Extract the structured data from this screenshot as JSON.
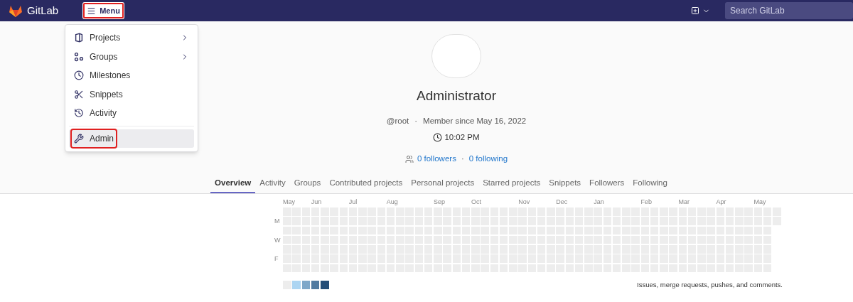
{
  "navbar": {
    "brand": "GitLab",
    "menu_button": {
      "label": "Menu",
      "highlighted": true
    },
    "search": {
      "placeholder": "Search GitLab"
    }
  },
  "menu": {
    "items": [
      {
        "kind": "projects",
        "label": "Projects",
        "submenu": true,
        "selected": false,
        "highlighted": false
      },
      {
        "kind": "groups",
        "label": "Groups",
        "submenu": true,
        "selected": false,
        "highlighted": false
      },
      {
        "kind": "milestones",
        "label": "Milestones",
        "submenu": false,
        "selected": false,
        "highlighted": false
      },
      {
        "kind": "snippets",
        "label": "Snippets",
        "submenu": false,
        "selected": false,
        "highlighted": false
      },
      {
        "kind": "activity",
        "label": "Activity",
        "submenu": false,
        "selected": false,
        "highlighted": false
      },
      {
        "kind": "admin",
        "label": "Admin",
        "submenu": false,
        "selected": true,
        "highlighted": true
      }
    ]
  },
  "profile": {
    "name": "Administrator",
    "username": "@root",
    "separator": "·",
    "member_since": "Member since May 16, 2022",
    "local_time": "10:02 PM",
    "followers": "0 followers",
    "follow_separator": "·",
    "following": "0 following"
  },
  "tabs": [
    {
      "label": "Overview",
      "selected": true
    },
    {
      "label": "Activity",
      "selected": false
    },
    {
      "label": "Groups",
      "selected": false
    },
    {
      "label": "Contributed projects",
      "selected": false
    },
    {
      "label": "Personal projects",
      "selected": false
    },
    {
      "label": "Starred projects",
      "selected": false
    },
    {
      "label": "Snippets",
      "selected": false
    },
    {
      "label": "Followers",
      "selected": false
    },
    {
      "label": "Following",
      "selected": false
    }
  ],
  "calendar": {
    "day_labels": [
      "M",
      "W",
      "F"
    ],
    "weeks": [
      {
        "kind": "full",
        "month": "May"
      },
      {
        "kind": "full"
      },
      {
        "kind": "full"
      },
      {
        "kind": "full",
        "month": "Jun"
      },
      {
        "kind": "full"
      },
      {
        "kind": "full"
      },
      {
        "kind": "full"
      },
      {
        "kind": "full",
        "month": "Jul"
      },
      {
        "kind": "full"
      },
      {
        "kind": "full"
      },
      {
        "kind": "full"
      },
      {
        "kind": "full",
        "month": "Aug"
      },
      {
        "kind": "full"
      },
      {
        "kind": "full"
      },
      {
        "kind": "full"
      },
      {
        "kind": "full"
      },
      {
        "kind": "full",
        "month": "Sep"
      },
      {
        "kind": "full"
      },
      {
        "kind": "full"
      },
      {
        "kind": "full"
      },
      {
        "kind": "full",
        "month": "Oct"
      },
      {
        "kind": "full"
      },
      {
        "kind": "full"
      },
      {
        "kind": "full"
      },
      {
        "kind": "full"
      },
      {
        "kind": "full",
        "month": "Nov"
      },
      {
        "kind": "full"
      },
      {
        "kind": "full"
      },
      {
        "kind": "full"
      },
      {
        "kind": "full",
        "month": "Dec"
      },
      {
        "kind": "full"
      },
      {
        "kind": "full"
      },
      {
        "kind": "full"
      },
      {
        "kind": "full",
        "month": "Jan"
      },
      {
        "kind": "full"
      },
      {
        "kind": "full"
      },
      {
        "kind": "full"
      },
      {
        "kind": "full"
      },
      {
        "kind": "full",
        "month": "Feb"
      },
      {
        "kind": "full"
      },
      {
        "kind": "full"
      },
      {
        "kind": "full"
      },
      {
        "kind": "full",
        "month": "Mar"
      },
      {
        "kind": "full"
      },
      {
        "kind": "full"
      },
      {
        "kind": "full"
      },
      {
        "kind": "full",
        "month": "Apr"
      },
      {
        "kind": "full"
      },
      {
        "kind": "full"
      },
      {
        "kind": "full"
      },
      {
        "kind": "full",
        "month": "May"
      },
      {
        "kind": "full"
      },
      {
        "kind": "current"
      }
    ],
    "legend": [
      {
        "color": "#ededed"
      },
      {
        "color": "#acd5f2"
      },
      {
        "color": "#7fa8c9"
      },
      {
        "color": "#527ba0"
      },
      {
        "color": "#254e77"
      }
    ],
    "note": "Issues, merge requests, pushes, and comments."
  }
}
